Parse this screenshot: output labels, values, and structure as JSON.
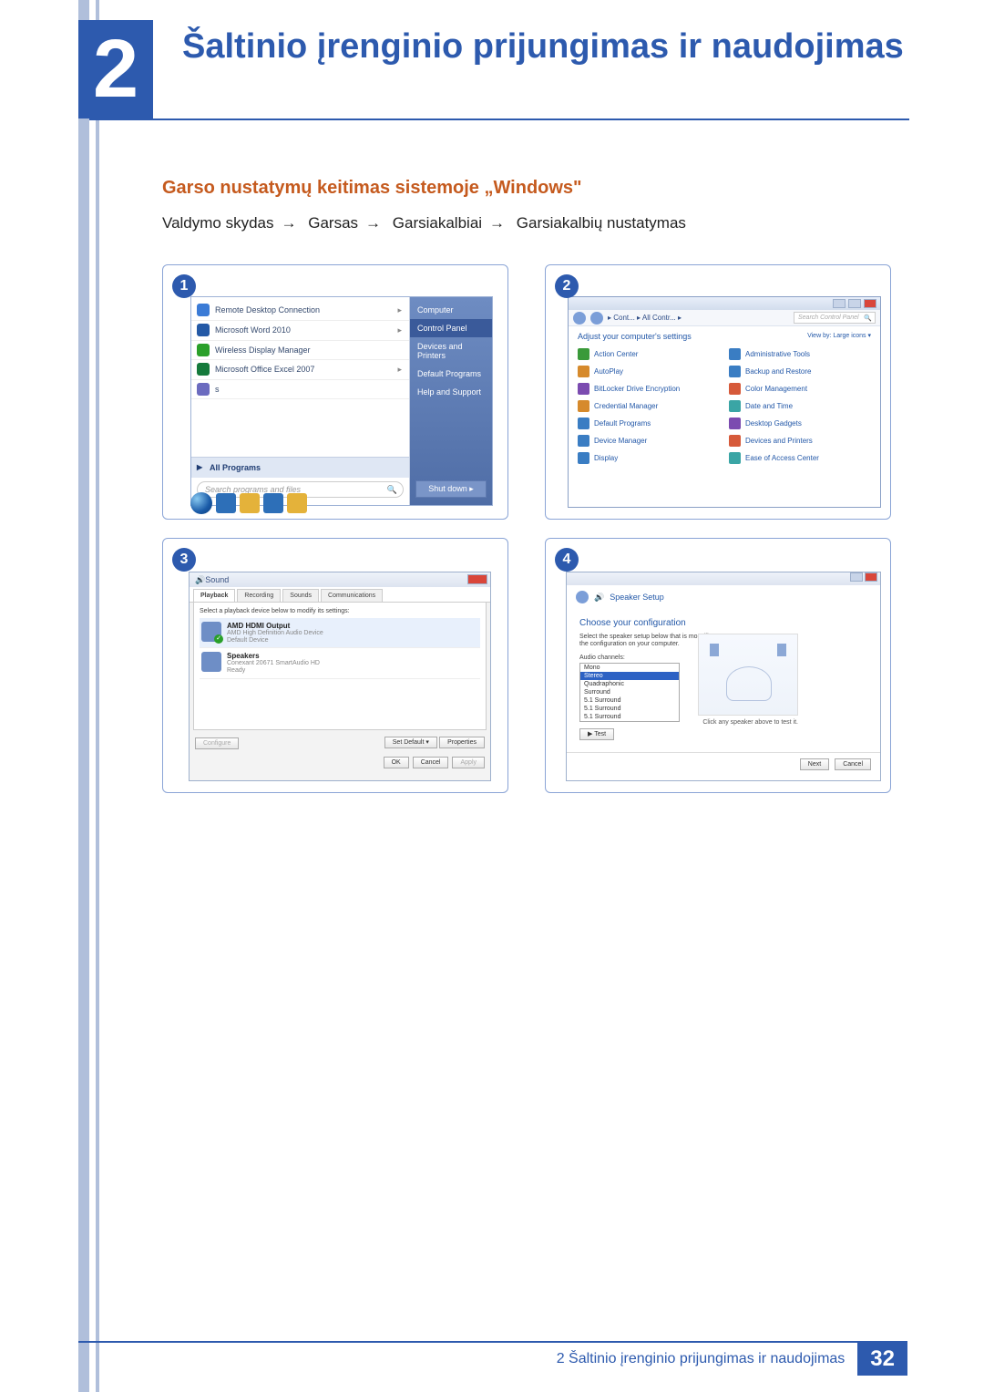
{
  "chapter": {
    "number": "2",
    "title": "Šaltinio įrenginio prijungimas ir naudojimas"
  },
  "section": {
    "heading": "Garso nustatymų keitimas sistemoje „Windows\""
  },
  "breadcrumb": {
    "p1": "Valdymo skydas",
    "p2": "Garsas",
    "p3": "Garsiakalbiai",
    "p4": "Garsiakalbių nustatymas"
  },
  "figures": {
    "n1": "1",
    "n2": "2",
    "n3": "3",
    "n4": "4"
  },
  "startmenu": {
    "items": {
      "rdc": "Remote Desktop Connection",
      "word": "Microsoft Word 2010",
      "wdm": "Wireless Display Manager",
      "excel": "Microsoft Office Excel 2007",
      "s": "s"
    },
    "all_programs": "All Programs",
    "search_placeholder": "Search programs and files",
    "right": {
      "computer": "Computer",
      "control_panel": "Control Panel",
      "devices": "Devices and Printers",
      "default_prog": "Default Programs",
      "help": "Help and Support"
    },
    "shutdown": "Shut down"
  },
  "controlpanel": {
    "crumb1": "Cont...",
    "crumb2": "All Contr...",
    "search_placeholder": "Search Control Panel",
    "header": "Adjust your computer's settings",
    "viewby": "View by:  Large icons ▾",
    "items": {
      "action_center": "Action Center",
      "admin_tools": "Administrative Tools",
      "autoplay": "AutoPlay",
      "backup": "Backup and Restore",
      "bitlocker": "BitLocker Drive Encryption",
      "color_mgmt": "Color Management",
      "cred_mgr": "Credential Manager",
      "date_time": "Date and Time",
      "default_prog": "Default Programs",
      "gadgets": "Desktop Gadgets",
      "device_mgr": "Device Manager",
      "dev_print": "Devices and Printers",
      "display": "Display",
      "ease": "Ease of Access Center"
    }
  },
  "sound": {
    "title": "Sound",
    "tabs": {
      "playback": "Playback",
      "recording": "Recording",
      "sounds": "Sounds",
      "comm": "Communications"
    },
    "desc": "Select a playback device below to modify its settings:",
    "dev1": {
      "name": "AMD HDMI Output",
      "line1": "AMD High Definition Audio Device",
      "line2": "Default Device"
    },
    "dev2": {
      "name": "Speakers",
      "line1": "Conexant 20671 SmartAudio HD",
      "line2": "Ready"
    },
    "configure": "Configure",
    "set_default": "Set Default ▾",
    "properties": "Properties",
    "ok": "OK",
    "cancel": "Cancel",
    "apply": "Apply"
  },
  "speaker": {
    "crumb": "Speaker Setup",
    "heading": "Choose your configuration",
    "sub": "Select the speaker setup below that is most like the configuration on your computer.",
    "channels_label": "Audio channels:",
    "options": {
      "mono": "Mono",
      "stereo": "Stereo",
      "quad": "Quadraphonic",
      "surr": "Surround",
      "s51a": "5.1 Surround",
      "s51b": "5.1 Surround",
      "s51c": "5.1 Surround"
    },
    "test": "▶ Test",
    "hint": "Click any speaker above to test it.",
    "next": "Next",
    "cancel": "Cancel"
  },
  "footer": {
    "text": "2 Šaltinio įrenginio prijungimas ir naudojimas",
    "page": "32"
  }
}
